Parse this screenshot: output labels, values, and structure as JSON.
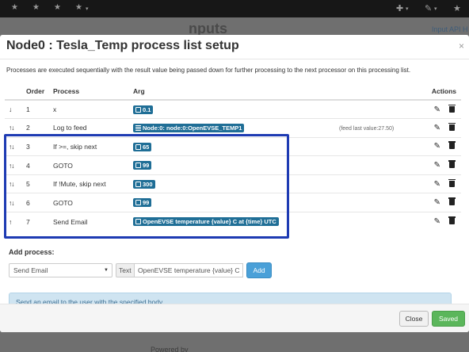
{
  "navbar": {
    "stars": [
      "★",
      "★",
      "★",
      "★"
    ],
    "caret": "▾",
    "plus_icon": "✚",
    "wrench_icon": "✎",
    "star_icon": "★"
  },
  "background": {
    "heading": "nputs",
    "input_api_link": "Input API H",
    "footer": "Powered by"
  },
  "modal": {
    "title": "Node0 : Tesla_Temp process list setup",
    "close_symbol": "×",
    "description": "Processes are executed sequentially with the result value being passed down for further processing to the next processor on this processing list.",
    "columns": {
      "order": "Order",
      "process": "Process",
      "arg": "Arg",
      "actions": "Actions"
    },
    "rows": [
      {
        "arrows": "↓",
        "order": "1",
        "process": "x",
        "arg": "0.1",
        "arg_kind": "value",
        "note": ""
      },
      {
        "arrows": "↑↓",
        "order": "2",
        "process": "Log to feed",
        "arg": "Node:0: node:0:OpenEVSE_TEMP1",
        "arg_kind": "feed",
        "note": "(feed last value:27.50)"
      },
      {
        "arrows": "↑↓",
        "order": "3",
        "process": "If >=, skip next",
        "arg": "65",
        "arg_kind": "value",
        "note": ""
      },
      {
        "arrows": "↑↓",
        "order": "4",
        "process": "GOTO",
        "arg": "99",
        "arg_kind": "value",
        "note": ""
      },
      {
        "arrows": "↑↓",
        "order": "5",
        "process": "If !Mute, skip next",
        "arg": "300",
        "arg_kind": "value",
        "note": ""
      },
      {
        "arrows": "↑↓",
        "order": "6",
        "process": "GOTO",
        "arg": "99",
        "arg_kind": "value",
        "note": ""
      },
      {
        "arrows": "↑",
        "order": "7",
        "process": "Send Email",
        "arg": "OpenEVSE temperature {value} C at {time} UTC",
        "arg_kind": "value",
        "note": ""
      }
    ],
    "edit_icon": "✎",
    "add_process": {
      "label": "Add process:",
      "selected_process": "Send Email",
      "select_caret": "▼",
      "text_addon": "Text",
      "text_value": "OpenEVSE temperature {value} C",
      "add_button": "Add"
    },
    "info_text": "Send an email to the user with the specified body.",
    "footer": {
      "close_button": "Close",
      "saved_button": "Saved"
    }
  },
  "colors": {
    "badge": "#1f6e96",
    "highlight": "#1e3bb3",
    "add_button": "#4aa0d8",
    "saved_button": "#5bb65b"
  }
}
